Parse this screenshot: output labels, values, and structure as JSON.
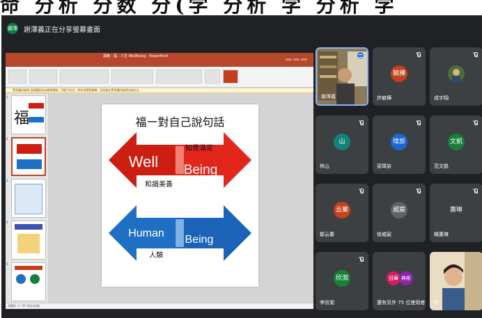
{
  "caption": {
    "text": "命 分析 分数 分(学 分析 学 分析 学"
  },
  "share_bar": {
    "avatar_text": "謝澤",
    "title": "謝澤義正在分享螢幕畫面",
    "avatar_color": "#0b8043"
  },
  "ppt": {
    "title": "講義 - 福 - 人生 WellBeing - PowerPoint",
    "notice": "受保護的檢視 這個檔案來自網際網路，可能不安全。除非您需要編輯，否則留在受保護的檢視比較安全。",
    "status": "投影片 2 / 25  中文(台灣)",
    "accent_color": "#b7472a",
    "thumb_numbers": [
      "1",
      "2",
      "3",
      "4",
      "5"
    ],
    "thumb_glyph": "福",
    "slide": {
      "title": "福ー對自己說句話",
      "top_arrow": {
        "left_word": "Well",
        "right_word": "Being",
        "caption_top": "知覺滿足",
        "caption_bottom": "和諧美善",
        "color": "#cc1f12"
      },
      "bottom_arrow": {
        "left_word": "Human",
        "right_word": "Being",
        "caption_bottom": "人類",
        "color": "#1f6fc4"
      }
    }
  },
  "participants": [
    {
      "id": "speaker",
      "name": "謝澤義",
      "video": true,
      "speaking": true
    },
    {
      "id": "p2",
      "name": "許毓樺",
      "avatar": "毓樺",
      "color": "#c5421b",
      "muted": true
    },
    {
      "id": "p3",
      "name": "成宇翔",
      "photo": true,
      "muted": true
    },
    {
      "id": "p4",
      "name": "林山",
      "avatar": "山",
      "color": "#12827a",
      "muted": true
    },
    {
      "id": "p5",
      "name": "梁瑋旂",
      "avatar": "瑋旂",
      "color": "#1967d2",
      "muted": true
    },
    {
      "id": "p6",
      "name": "范文凱",
      "avatar": "文凱",
      "color": "#188038",
      "muted": true
    },
    {
      "id": "p7",
      "name": "鄒云蓁",
      "avatar": "云蓁",
      "color": "#c5421b",
      "muted": true
    },
    {
      "id": "p8",
      "name": "徐威宸",
      "avatar": "威宸",
      "color": "#5f6368",
      "muted": true
    },
    {
      "id": "p9",
      "name": "楊惠琳",
      "avatar": "蕙琳",
      "color": "#3c4043",
      "muted": true
    },
    {
      "id": "p10",
      "name": "李欣洳",
      "avatar": "欣洳",
      "color": "#188038",
      "muted": true
    },
    {
      "id": "p11",
      "name": "還有另外 75 位使用者",
      "avatar_a": "冠華",
      "avatar_b": "典彬",
      "color_a": "#d81b60",
      "color_b": "#8e24aa"
    },
    {
      "id": "p12",
      "name": "你",
      "video": true
    }
  ]
}
